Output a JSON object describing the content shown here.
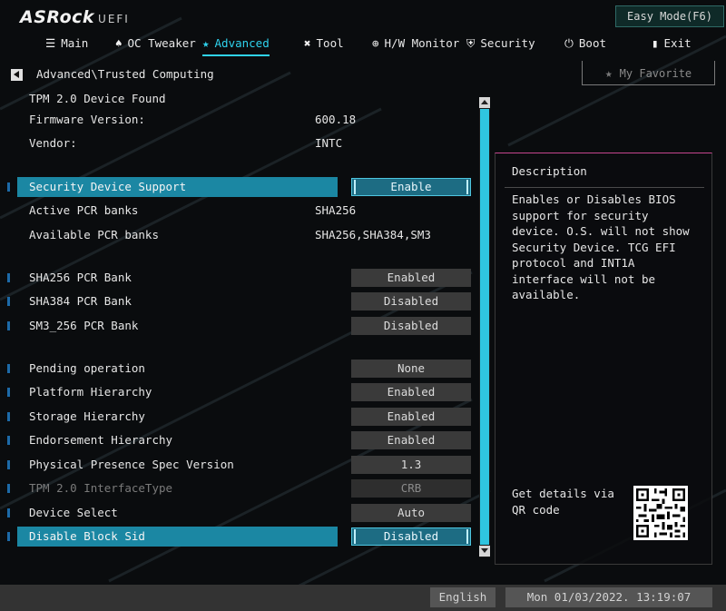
{
  "app": {
    "logo": "ASRock",
    "logo_suffix": "UEFI",
    "easy_mode": "Easy Mode(F6)"
  },
  "nav": [
    {
      "label": "Main",
      "icon": "list-icon"
    },
    {
      "label": "OC Tweaker",
      "icon": "rocket-icon"
    },
    {
      "label": "Advanced",
      "icon": "star-icon",
      "active": true
    },
    {
      "label": "Tool",
      "icon": "tools-icon"
    },
    {
      "label": "H/W Monitor",
      "icon": "monitor-icon"
    },
    {
      "label": "Security",
      "icon": "shield-icon"
    },
    {
      "label": "Boot",
      "icon": "power-icon"
    },
    {
      "label": "Exit",
      "icon": "exit-icon"
    }
  ],
  "breadcrumb": "Advanced\\Trusted Computing",
  "favorite": "My Favorite",
  "info": {
    "tpm_found": "TPM 2.0 Device Found",
    "firmware_label": "Firmware Version:",
    "firmware_value": "600.18",
    "vendor_label": "Vendor:",
    "vendor_value": "INTC"
  },
  "security_device_support": {
    "label": "Security Device Support",
    "value": "Enable"
  },
  "active_pcr": {
    "label": "Active PCR banks",
    "value": "SHA256"
  },
  "available_pcr": {
    "label": "Available PCR banks",
    "value": "SHA256,SHA384,SM3"
  },
  "pcr_banks": [
    {
      "label": "SHA256 PCR Bank",
      "value": "Enabled"
    },
    {
      "label": "SHA384 PCR Bank",
      "value": "Disabled"
    },
    {
      "label": "SM3_256 PCR Bank",
      "value": "Disabled"
    }
  ],
  "settings": [
    {
      "label": "Pending operation",
      "value": "None"
    },
    {
      "label": "Platform Hierarchy",
      "value": "Enabled"
    },
    {
      "label": "Storage Hierarchy",
      "value": "Enabled"
    },
    {
      "label": "Endorsement Hierarchy",
      "value": "Enabled"
    },
    {
      "label": "Physical Presence Spec Version",
      "value": "1.3"
    },
    {
      "label": "TPM 2.0 InterfaceType",
      "value": "CRB"
    },
    {
      "label": "Device Select",
      "value": "Auto"
    },
    {
      "label": "Disable Block Sid",
      "value": "Disabled"
    }
  ],
  "description": {
    "title": "Description",
    "text": "Enables or Disables BIOS support for security device. O.S. will not show Security Device. TCG EFI protocol and INT1A interface will not be available.",
    "qr_text": "Get details via QR code"
  },
  "footer": {
    "language": "English",
    "datetime": "Mon 01/03/2022. 13:19:07"
  },
  "colors": {
    "accent": "#2fd3ee",
    "highlight": "#1b87a3",
    "panel_border": "#c5458e"
  }
}
